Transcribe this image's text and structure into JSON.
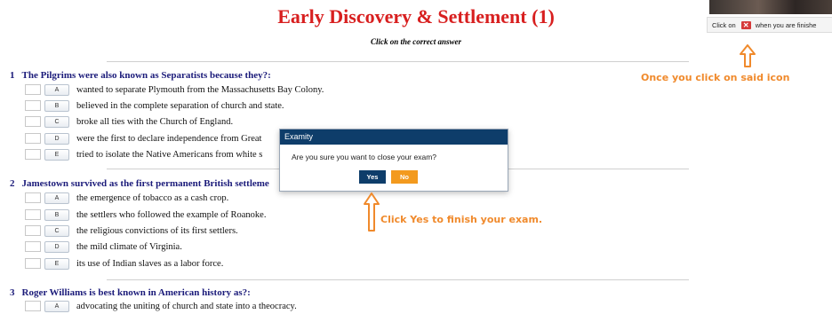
{
  "header": {
    "title": "Early Discovery & Settlement (1)",
    "subtitle": "Click on the correct answer"
  },
  "finish_bar": {
    "text_before": "Click on",
    "text_after": "when you are finishe",
    "icon": "close-x-icon"
  },
  "annotations": {
    "top": "Once you click on said icon",
    "bottom": "Click Yes to finish your exam.",
    "arrow_icon": "up-arrow-icon"
  },
  "dialog": {
    "title": "Examity",
    "message": "Are you sure you want to close your exam?",
    "yes_label": "Yes",
    "no_label": "No"
  },
  "questions": [
    {
      "number": "1",
      "text": "The Pilgrims were also known as Separatists because they?:",
      "options": [
        {
          "letter": "A",
          "text": "wanted to separate Plymouth from the Massachusetts Bay Colony."
        },
        {
          "letter": "B",
          "text": "believed in the complete separation of church and state."
        },
        {
          "letter": "C",
          "text": "broke all ties with the Church of England."
        },
        {
          "letter": "D",
          "text": "were the first to declare independence from Great"
        },
        {
          "letter": "E",
          "text": "tried to isolate the Native Americans from white s"
        }
      ]
    },
    {
      "number": "2",
      "text": "Jamestown survived as the first permanent British settleme",
      "options": [
        {
          "letter": "A",
          "text": "the emergence of tobacco as a cash crop."
        },
        {
          "letter": "B",
          "text": "the settlers who followed the example of Roanoke."
        },
        {
          "letter": "C",
          "text": "the religious convictions of its first settlers."
        },
        {
          "letter": "D",
          "text": "the mild climate of Virginia."
        },
        {
          "letter": "E",
          "text": "its use of Indian slaves as a labor force."
        }
      ]
    },
    {
      "number": "3",
      "text": "Roger Williams is best known in American history as?:",
      "options": [
        {
          "letter": "A",
          "text": "advocating the uniting of church and state into a theocracy."
        }
      ]
    }
  ],
  "colors": {
    "title": "#d81f1f",
    "question": "#1b1b7a",
    "annotation": "#f08a2c",
    "dialog_header": "#0e3d6a",
    "yes_button": "#0e3d6a",
    "no_button": "#f39a1e"
  }
}
